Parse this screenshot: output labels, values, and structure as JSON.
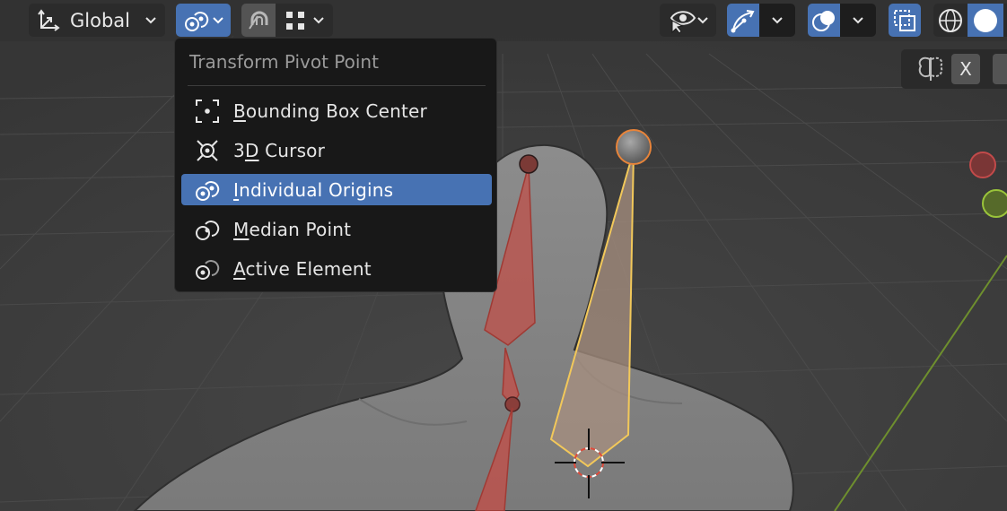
{
  "header": {
    "orientation": {
      "label": "Global",
      "icon": "transform-orientation-icon"
    },
    "pivot_button": {
      "icon": "individual-origins-icon"
    },
    "snap": {
      "icon": "magnet-icon",
      "grid_icon": "snap-grid-icon"
    },
    "visibility_icon": "eye-arrow-icon",
    "gizmo_icon": "gizmo-arrow-icon",
    "overlay_icon": "overlay-circles-icon",
    "xray_icon": "xray-icon",
    "shading": {
      "wireframe_icon": "wireframe-sphere-icon",
      "solid_icon": "solid-sphere-icon"
    }
  },
  "pivot_menu": {
    "title": "Transform Pivot Point",
    "items": [
      {
        "pre": "",
        "ul": "B",
        "post": "ounding Box Center",
        "icon": "bounding-box-center-icon",
        "active": false
      },
      {
        "pre": "3",
        "ul": "D",
        "post": " Cursor",
        "icon": "3d-cursor-icon",
        "active": false
      },
      {
        "pre": "",
        "ul": "I",
        "post": "ndividual Origins",
        "icon": "individual-origins-icon",
        "active": true
      },
      {
        "pre": "",
        "ul": "M",
        "post": "edian Point",
        "icon": "median-point-icon",
        "active": false
      },
      {
        "pre": "",
        "ul": "A",
        "post": "ctive Element",
        "icon": "active-element-icon",
        "active": false
      }
    ]
  },
  "mirror_panel": {
    "icon": "mirror-butterfly-icon",
    "axis_label": "X"
  },
  "colors": {
    "viewport_bg": "#3d3d3d",
    "menu_bg": "#181818",
    "highlight": "#4772b3",
    "bone_red": "#c0504a",
    "bone_selected": "#f2c85a",
    "joint_active": "#e8843a",
    "axis_green": "#6e8f2e"
  }
}
